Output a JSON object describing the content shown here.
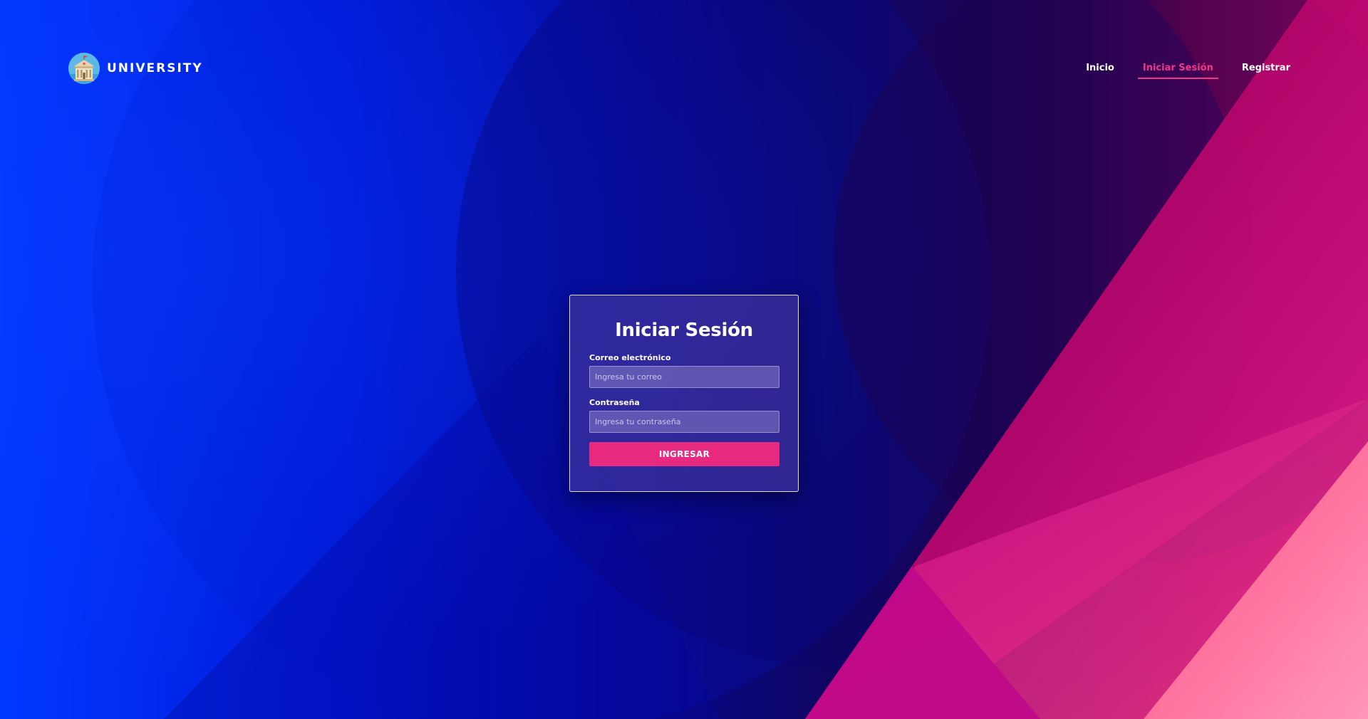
{
  "brand": {
    "name": "UNIVERSITY",
    "logo_icon": "university-building-icon"
  },
  "nav": {
    "items": [
      {
        "label": "Inicio",
        "active": false
      },
      {
        "label": "Iniciar Sesión",
        "active": true
      },
      {
        "label": "Registrar",
        "active": false
      }
    ]
  },
  "login": {
    "title": "Iniciar Sesión",
    "email_label": "Correo electrónico",
    "email_placeholder": "Ingresa tu correo",
    "email_value": "",
    "password_label": "Contraseña",
    "password_placeholder": "Ingresa tu contraseña",
    "password_value": "",
    "submit_label": "INGRESAR"
  },
  "colors": {
    "accent": "#e7297f",
    "nav_active": "#f0378c",
    "bg_blue": "#0138ff",
    "bg_navy": "#10065e",
    "bg_magenta": "#c0086a"
  }
}
